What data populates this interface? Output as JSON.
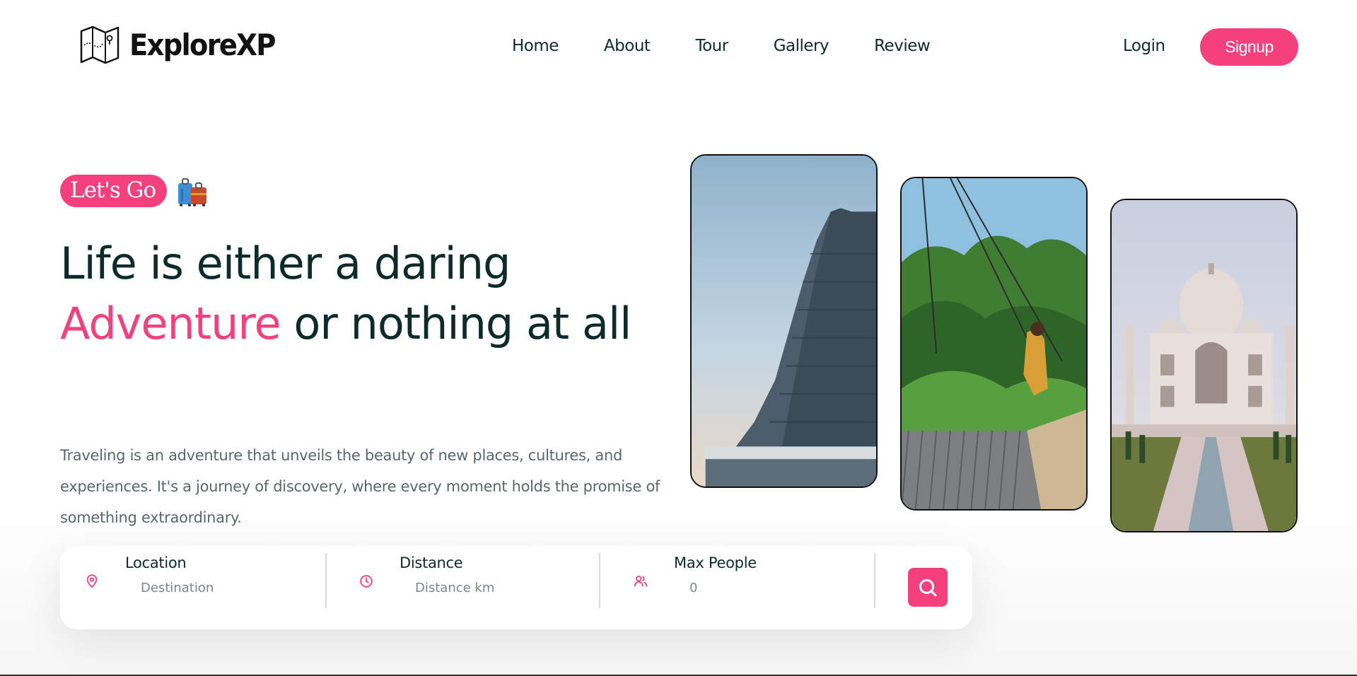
{
  "brand": {
    "name": "ExploreXP",
    "accent_color": "#f5407e",
    "text_color": "#0f2a2a"
  },
  "nav": {
    "items": [
      {
        "label": "Home"
      },
      {
        "label": "About"
      },
      {
        "label": "Tour"
      },
      {
        "label": "Gallery"
      },
      {
        "label": "Review"
      }
    ],
    "login_label": "Login",
    "signup_label": "Signup"
  },
  "hero": {
    "badge": "Let's Go",
    "badge_icon": "suitcase-icon",
    "headline_part1": "Life is either a daring ",
    "headline_accent": "Adventure",
    "headline_part2": " or nothing at all",
    "description": "Traveling is an adventure that unveils the beauty of new places, cultures, and experiences. It's a journey of discovery, where every moment holds the promise of something extraordinary."
  },
  "search": {
    "location": {
      "label": "Location",
      "placeholder": "Destination",
      "icon": "map-pin-icon"
    },
    "distance": {
      "label": "Distance",
      "placeholder": "Distance km",
      "icon": "clock-icon"
    },
    "people": {
      "label": "Max People",
      "placeholder": "0",
      "icon": "users-icon"
    },
    "button_icon": "search-icon"
  },
  "gallery": {
    "images": [
      {
        "name": "temple-tower-image"
      },
      {
        "name": "jungle-swing-image"
      },
      {
        "name": "taj-mahal-image"
      }
    ]
  }
}
